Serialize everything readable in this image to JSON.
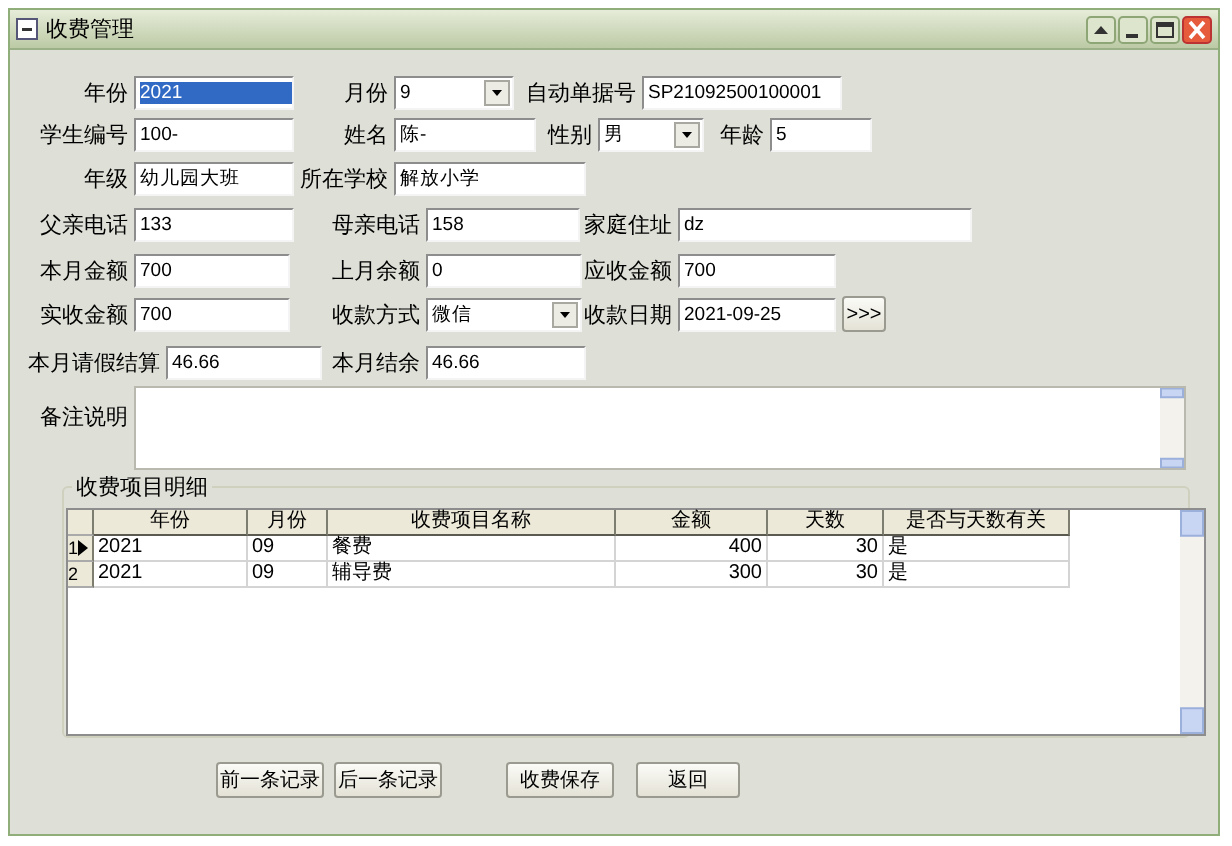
{
  "window": {
    "title": "收费管理"
  },
  "form": {
    "rows": [
      [
        {
          "label": "年份",
          "value": "2021",
          "kind": "text",
          "highlighted": true
        },
        {
          "label": "月份",
          "value": "9",
          "kind": "select",
          "highlighted": false
        },
        {
          "label": "自动单据号",
          "value": "SP21092500100001",
          "kind": "text",
          "highlighted": false
        }
      ],
      [
        {
          "label": "学生编号",
          "value": "100-",
          "kind": "text",
          "highlighted": false
        },
        {
          "label": "姓名",
          "value": "陈-",
          "kind": "text",
          "highlighted": false
        },
        {
          "label": "性别",
          "value": "男",
          "kind": "select",
          "highlighted": false
        },
        {
          "label": "年龄",
          "value": "5",
          "kind": "text",
          "highlighted": false
        }
      ],
      [
        {
          "label": "年级",
          "value": "幼儿园大班",
          "kind": "text",
          "highlighted": false
        },
        {
          "label": "所在学校",
          "value": "解放小学",
          "kind": "text",
          "highlighted": false
        }
      ],
      [
        {
          "label": "父亲电话",
          "value": "133",
          "kind": "text",
          "highlighted": false
        },
        {
          "label": "母亲电话",
          "value": "158",
          "kind": "text",
          "highlighted": false
        },
        {
          "label": "家庭住址",
          "value": "dz",
          "kind": "text",
          "highlighted": false
        }
      ],
      [
        {
          "label": "本月金额",
          "value": "700",
          "kind": "text",
          "highlighted": false
        },
        {
          "label": "上月余额",
          "value": "0",
          "kind": "text",
          "highlighted": false
        },
        {
          "label": "应收金额",
          "value": "700",
          "kind": "text",
          "highlighted": false
        }
      ],
      [
        {
          "label": "实收金额",
          "value": "700",
          "kind": "text",
          "highlighted": false
        },
        {
          "label": "收款方式",
          "value": "微信",
          "kind": "select",
          "highlighted": false
        },
        {
          "label": "收款日期",
          "value": "2021-09-25",
          "kind": "text",
          "highlighted": false
        },
        {
          "label": ">>>",
          "kind": "button"
        }
      ],
      [
        {
          "label": "本月请假结算",
          "value": "46.66",
          "kind": "text",
          "highlighted": false
        },
        {
          "label": "本月结余",
          "value": "46.66",
          "kind": "text",
          "highlighted": false
        }
      ]
    ],
    "notes": {
      "label": "备注说明"
    }
  },
  "details": {
    "title": "收费项目明细",
    "table": {
      "columns": [
        "年份",
        "月份",
        "收费项目名称",
        "金额",
        "天数",
        "是否与天数有关"
      ],
      "rows": [
        {
          "number": "1",
          "current": true,
          "cells": [
            "2021",
            "09",
            "餐费",
            "400",
            "30",
            "是"
          ]
        },
        {
          "number": "2",
          "current": false,
          "cells": [
            "2021",
            "09",
            "辅导费",
            "300",
            "30",
            "是"
          ]
        }
      ]
    }
  },
  "buttons": [
    "前一条记录",
    "后一条记录",
    "收费保存",
    "返回"
  ]
}
